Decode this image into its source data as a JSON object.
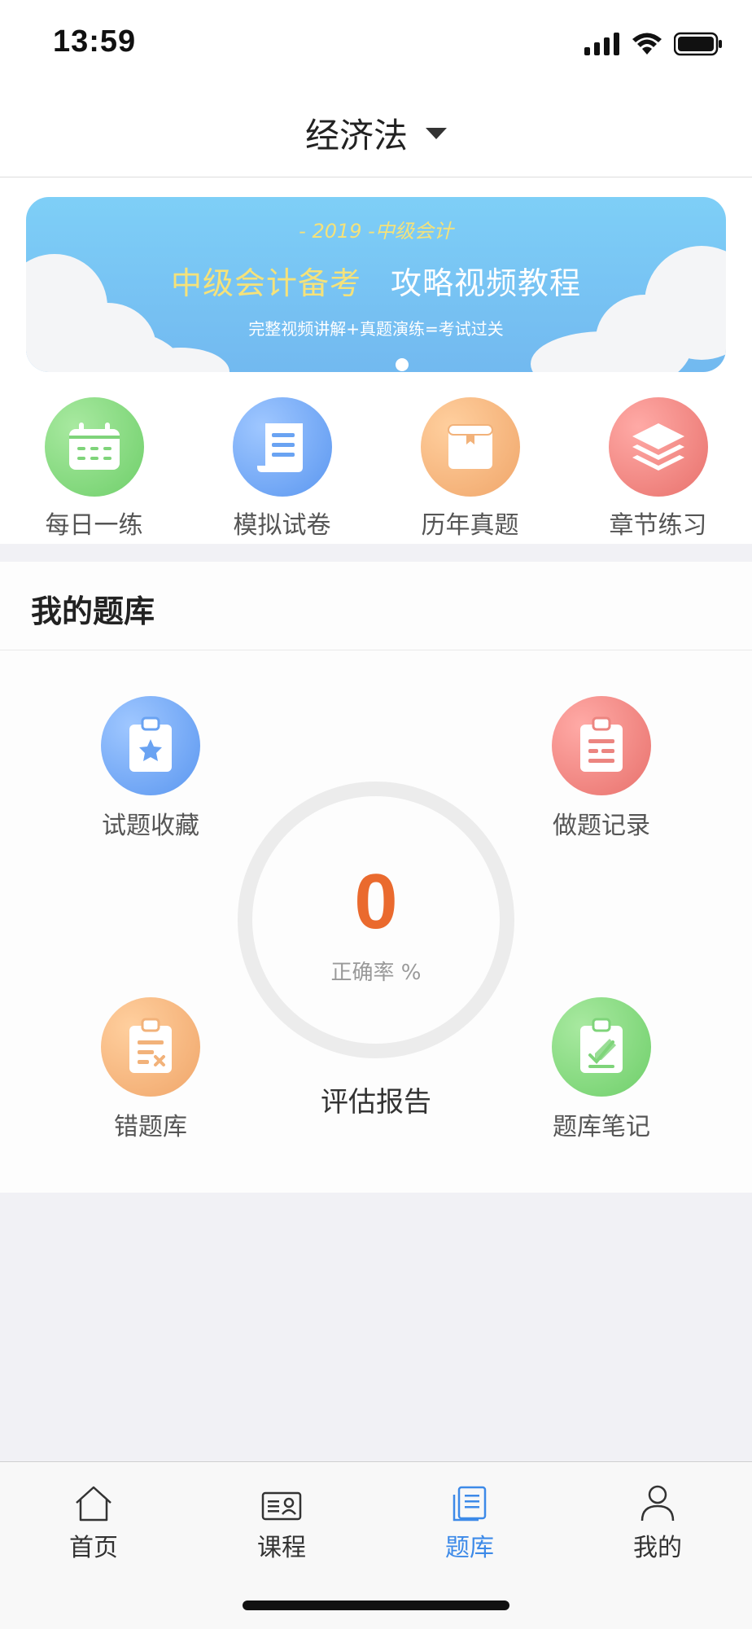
{
  "status_bar": {
    "time": "13:59",
    "icons": [
      "signal-icon",
      "wifi-icon",
      "battery-icon"
    ]
  },
  "header": {
    "title": "经济法",
    "dropdown_icon": "caret-down-icon"
  },
  "banner": {
    "subtitle": "- 2019 -中级会计",
    "headline_yellow": "中级会计备考",
    "headline_white": "攻略视频教程",
    "description": "完整视频讲解+真题演练=考试过关",
    "slide_count": 1
  },
  "quick_actions": [
    {
      "label": "每日一练",
      "icon": "calendar-icon",
      "color": "#6fcf6a"
    },
    {
      "label": "模拟试卷",
      "icon": "scroll-icon",
      "color": "#5b97f0"
    },
    {
      "label": "历年真题",
      "icon": "archive-box-icon",
      "color": "#f0a66a"
    },
    {
      "label": "章节练习",
      "icon": "layers-icon",
      "color": "#e8716c"
    }
  ],
  "my_bank": {
    "title": "我的题库",
    "items": [
      {
        "label": "试题收藏",
        "icon": "clipboard-star-icon"
      },
      {
        "label": "做题记录",
        "icon": "clipboard-list-icon"
      },
      {
        "label": "错题库",
        "icon": "clipboard-x-icon"
      },
      {
        "label": "题库笔记",
        "icon": "clipboard-pen-icon"
      }
    ],
    "accuracy_value": "0",
    "accuracy_caption": "正确率 %",
    "report_label": "评估报告"
  },
  "tabbar": {
    "active": "题库",
    "tabs": [
      {
        "label": "首页",
        "icon": "home-icon"
      },
      {
        "label": "课程",
        "icon": "course-card-icon"
      },
      {
        "label": "题库",
        "icon": "question-bank-icon"
      },
      {
        "label": "我的",
        "icon": "user-icon"
      }
    ]
  },
  "colors": {
    "accent": "#3d8ae8",
    "accuracy": "#ea6a2e",
    "banner_yellow": "#f5e27a"
  }
}
